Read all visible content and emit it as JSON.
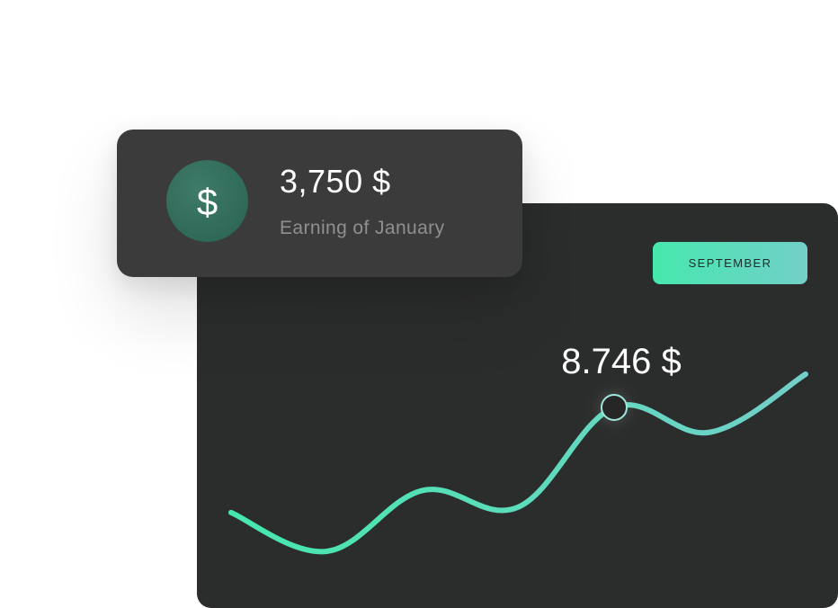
{
  "earning_card": {
    "icon": "dollar-icon",
    "icon_glyph": "$",
    "amount": "3,750 $",
    "label": "Earning of January",
    "icon_color": "#2f6958"
  },
  "chart_card": {
    "month_button": "SEPTEMBER",
    "highlight_value": "8.746 $",
    "accent_start": "#46e8ad",
    "accent_end": "#72cfc9"
  },
  "chart_data": {
    "type": "line",
    "xlabel": "",
    "ylabel": "",
    "grid": false,
    "series": [
      {
        "values": [
          4.6,
          3.2,
          5.4,
          4.8,
          8.4,
          7.5,
          9.6
        ]
      }
    ],
    "highlight": {
      "index": 4,
      "label": "8.746 $"
    }
  }
}
